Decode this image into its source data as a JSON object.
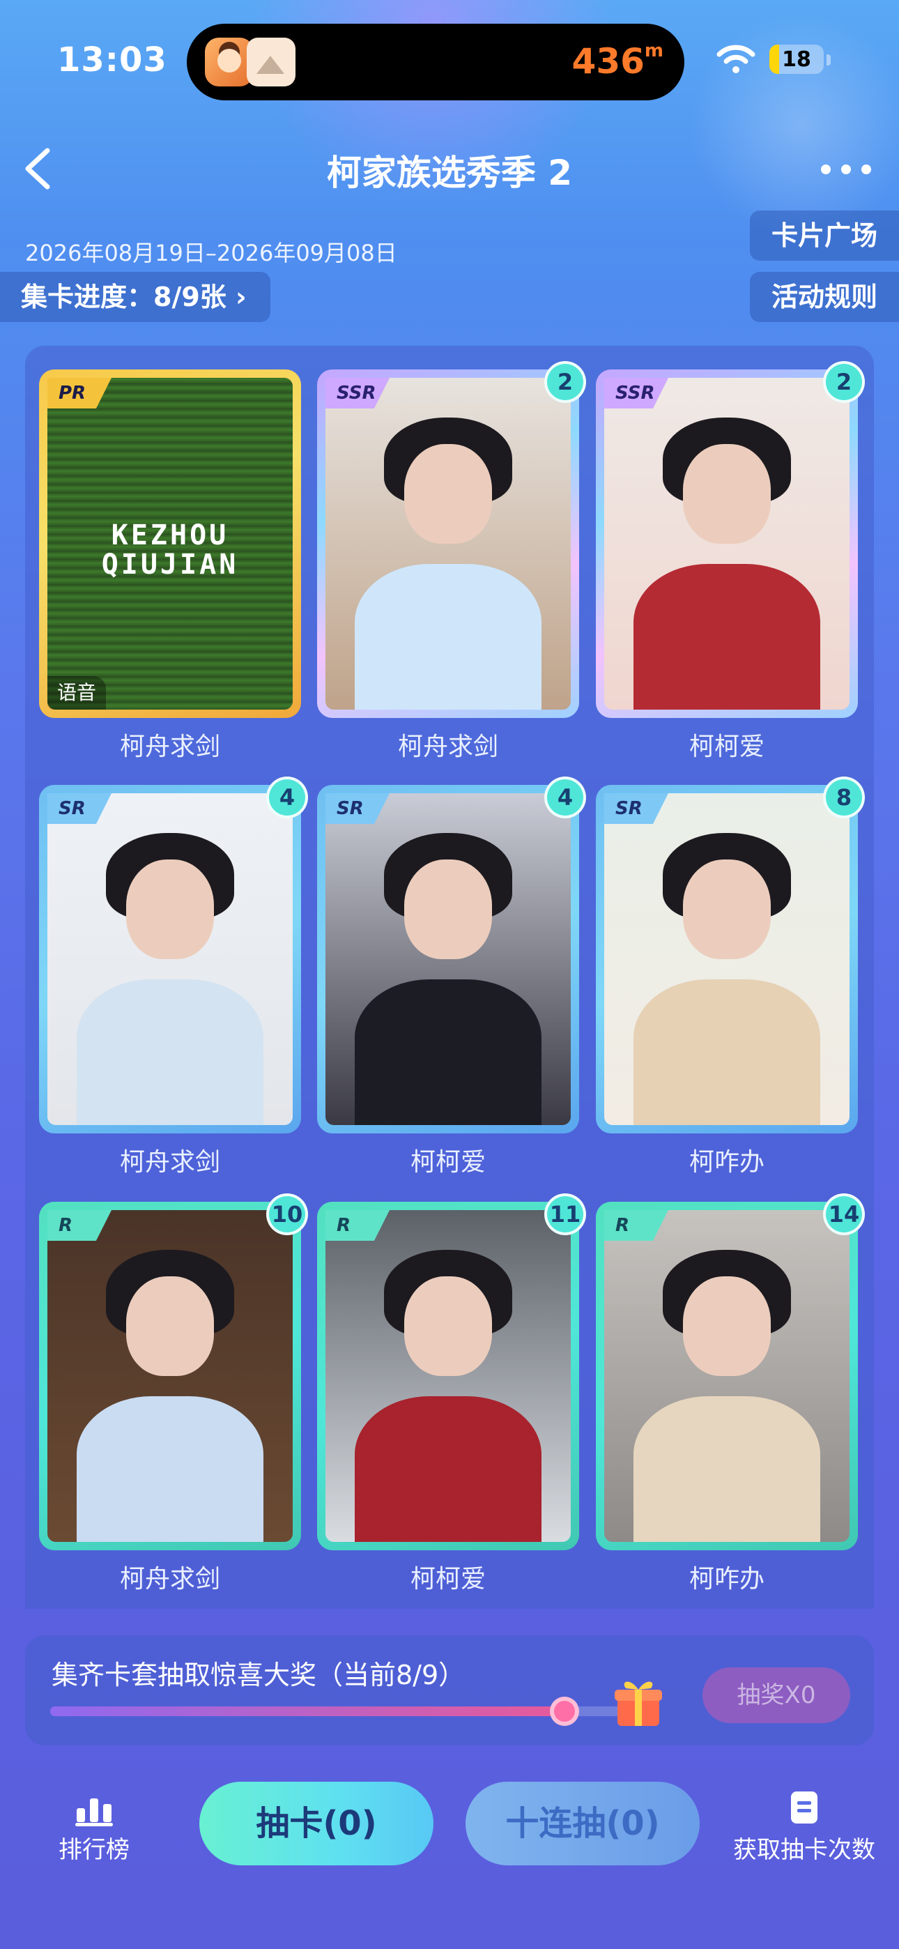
{
  "status_bar": {
    "time": "13:03",
    "activity_distance": "436",
    "activity_unit": "m",
    "battery": "18",
    "battery_level": 0.18
  },
  "header": {
    "title": "柯家族选秀季 2",
    "date_range": "2026年08月19日–2026年09月08日",
    "progress_label": "集卡进度：8/9张 ›",
    "card_plaza_button": "卡片广场",
    "rules_button": "活动规则"
  },
  "cards": [
    {
      "name": "柯舟求剑",
      "rarity": "PR",
      "count": "",
      "voice_label": "语音",
      "art_text": "KEZHOU\nQIUJIAN"
    },
    {
      "name": "柯舟求剑",
      "rarity": "SSR",
      "count": "2"
    },
    {
      "name": "柯柯爱",
      "rarity": "SSR",
      "count": "2"
    },
    {
      "name": "柯舟求剑",
      "rarity": "SR",
      "count": "4"
    },
    {
      "name": "柯柯爱",
      "rarity": "SR",
      "count": "4"
    },
    {
      "name": "柯咋办",
      "rarity": "SR",
      "count": "8"
    },
    {
      "name": "柯舟求剑",
      "rarity": "R",
      "count": "10"
    },
    {
      "name": "柯柯爱",
      "rarity": "R",
      "count": "11"
    },
    {
      "name": "柯咋办",
      "rarity": "R",
      "count": "14"
    }
  ],
  "prize": {
    "text": "集齐卡套抽取惊喜大奖（当前8/9）",
    "progress": 0.8889,
    "lottery_button": "抽奖X0"
  },
  "bottom": {
    "rank_label": "排行榜",
    "draw_button": "抽卡(0)",
    "ten_draw_button": "十连抽(0)",
    "get_draws_label": "获取抽卡次数"
  },
  "colors": {
    "pr_frame": "#f7c94a",
    "ssr_frame": "#c6a6ff",
    "sr_frame": "#6fbff2",
    "r_frame": "#53e0c0",
    "badge": "#4fe6d8",
    "accent_orange": "#ff7a2a"
  }
}
